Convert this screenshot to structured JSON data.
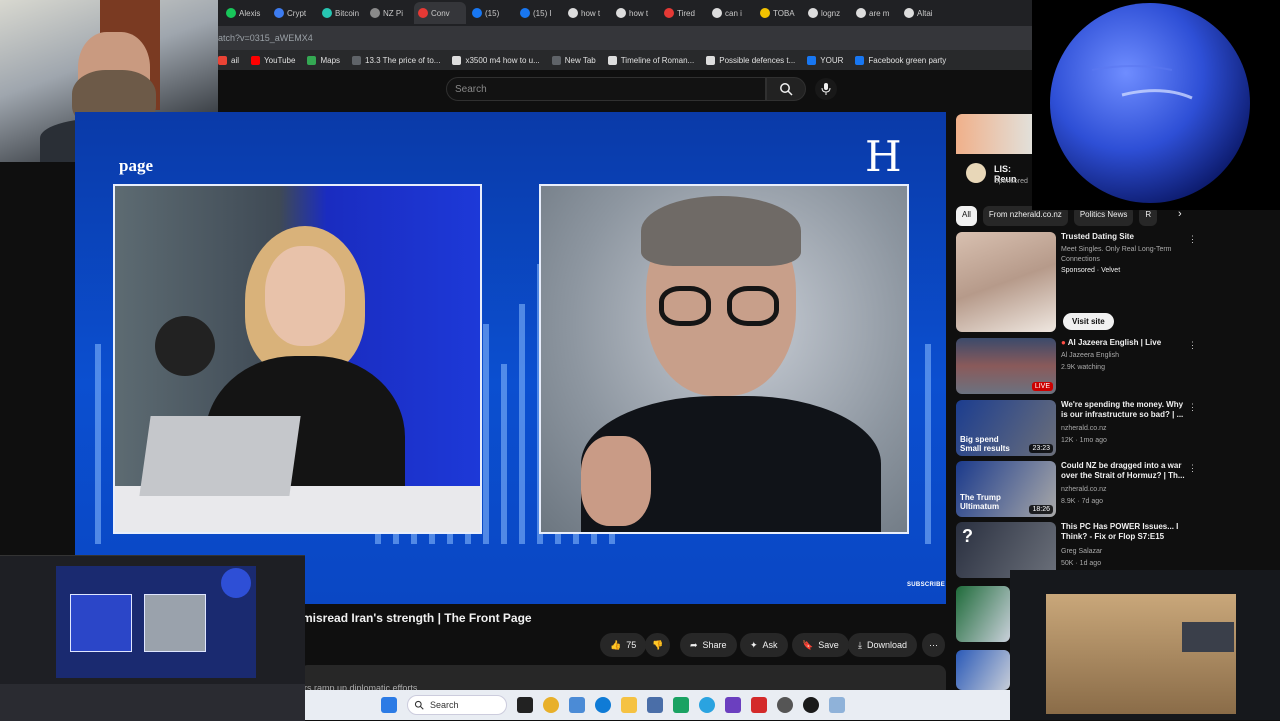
{
  "browser": {
    "tabs": [
      "Alexis",
      "Crypt",
      "Bitcoin",
      "NZ Pi",
      "Conv",
      "(15)",
      "(15) I",
      "how t",
      "how t",
      "Tired",
      "can i",
      "TOBA",
      "lognz",
      "are m",
      "Altai"
    ],
    "tab_colors": [
      "#18c65a",
      "#3d7cf0",
      "#27c6b2",
      "#8a8a8a",
      "#e53935",
      "#1877f2",
      "#1877f2",
      "#dddddd",
      "#dddddd",
      "#e53935",
      "#dddddd",
      "#f2c200",
      "#dddddd",
      "#dddddd",
      "#dddddd"
    ],
    "address": "atch?v=0315_aWEMX4",
    "bookmarks": [
      {
        "label": "ail",
        "color": "#ea4335"
      },
      {
        "label": "YouTube",
        "color": "#ff0000"
      },
      {
        "label": "Maps",
        "color": "#34a853"
      },
      {
        "label": "13.3 The price of to...",
        "color": "#5f6368"
      },
      {
        "label": "x3500 m4 how to u...",
        "color": "#dddddd"
      },
      {
        "label": "New Tab",
        "color": "#5f6368"
      },
      {
        "label": "Timeline of Roman...",
        "color": "#dddddd"
      },
      {
        "label": "Possible defences t...",
        "color": "#dddddd"
      },
      {
        "label": "YOUR",
        "color": "#1877f2"
      },
      {
        "label": "Facebook green party",
        "color": "#1877f2"
      }
    ]
  },
  "yt": {
    "search_placeholder": "Search",
    "video_brand": "page",
    "video_brand_logo": "H",
    "subscribe_overlay": "SUBSCRIBE",
    "title": "misread Iran's strength | The Front Page",
    "like_count": "75",
    "share": "Share",
    "ask": "Ask",
    "save": "Save",
    "download": "Download",
    "description": "rs ramp up diplomatic efforts"
  },
  "sidebar": {
    "ad_title": "LIS: Reun",
    "ad_sponsored": "Sponsored",
    "chips": [
      "All",
      "From nzherald.co.nz",
      "Politics News",
      "R"
    ],
    "recs": [
      {
        "title": "Trusted Dating Site",
        "line2": "Meet Singles. Only Real Long-Term Connections",
        "meta": "Sponsored · Velvet",
        "button": "Visit site"
      },
      {
        "title": "Al Jazeera English | Live",
        "channel": "Al Jazeera English",
        "meta": "2.9K watching",
        "badge": "LIVE"
      },
      {
        "title": "We're spending the money. Why is our infrastructure so bad? | ...",
        "channel": "nzherald.co.nz",
        "meta": "12K · 1mo ago",
        "duration": "23:23",
        "overlay": "Big spend Small results"
      },
      {
        "title": "Could NZ be dragged into a war over the Strait of Hormuz? | Th...",
        "channel": "nzherald.co.nz",
        "meta": "8.9K · 7d ago",
        "duration": "18:26",
        "overlay": "The Trump Ultimatum"
      },
      {
        "title": "This PC Has POWER Issues... I Think? - Fix or Flop S7:E15",
        "channel": "Greg Salazar",
        "meta": "50K · 1d ago",
        "overlay": "?"
      }
    ]
  },
  "taskbar": {
    "search": "Search"
  }
}
